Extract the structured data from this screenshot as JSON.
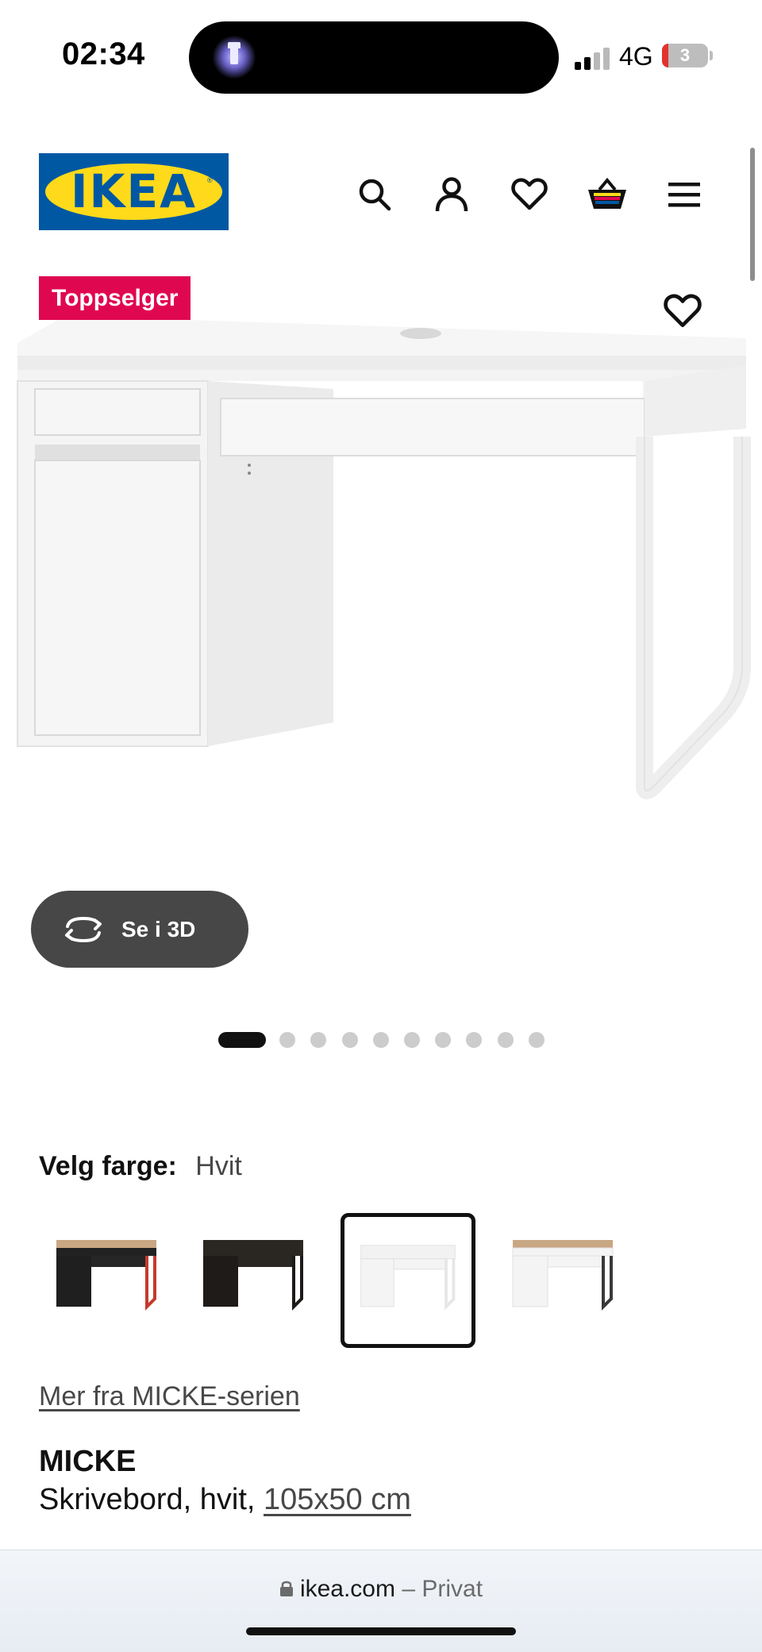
{
  "status_bar": {
    "time": "02:34",
    "network": "4G",
    "battery": "3"
  },
  "header": {
    "logo_text": "IKEA",
    "icons": [
      "search-icon",
      "account-icon",
      "heart-icon",
      "basket-icon",
      "menu-icon"
    ]
  },
  "product": {
    "badge": "Toppselger",
    "see_3d": "Se i 3D",
    "gallery": {
      "total": 10,
      "active": 1
    },
    "color_label": "Velg farge:",
    "color_value": "Hvit",
    "swatches": [
      {
        "top": "#222222",
        "leg": "#c43b2c",
        "selected": false
      },
      {
        "top": "#2a2622",
        "leg": "#1d1b19",
        "selected": false
      },
      {
        "top": "#f4f4f4",
        "leg": "#ececec",
        "selected": true
      },
      {
        "top": "#c9a783",
        "leg": "#3a3a3a",
        "selected": false
      }
    ],
    "series_link": "Mer fra MICKE-serien",
    "name": "MICKE",
    "desc_prefix": "Skrivebord, hvit,",
    "desc_size": "105x50 cm"
  },
  "browser": {
    "domain": "ikea.com",
    "separator": "–",
    "mode": "Privat"
  },
  "colors": {
    "brand_blue": "#0058a3",
    "brand_yellow": "#ffda1a",
    "badge_red": "#e00751"
  }
}
